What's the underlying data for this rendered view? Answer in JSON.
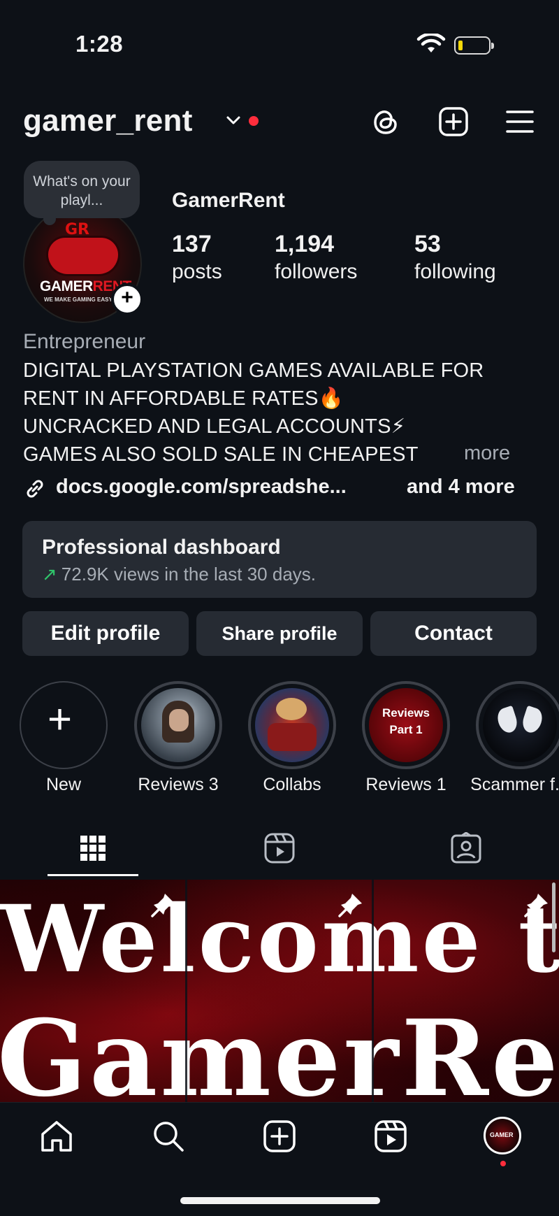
{
  "status_bar": {
    "time": "1:28"
  },
  "header": {
    "username": "gamer_rent"
  },
  "profile": {
    "note": "What's on your playl...",
    "avatar_brand_a": "GAMER",
    "avatar_brand_b": "RENT",
    "avatar_initials": "GR",
    "avatar_tagline": "WE MAKE GAMING EASY",
    "display_name": "GamerRent",
    "stats": [
      {
        "value": "137",
        "label": "posts"
      },
      {
        "value": "1,194",
        "label": "followers"
      },
      {
        "value": "53",
        "label": "following"
      }
    ],
    "category": "Entrepreneur",
    "bio_lines": [
      "DIGITAL PLAYSTATION GAMES AVAILABLE FOR",
      "RENT IN AFFORDABLE RATES🔥",
      "UNCRACKED AND LEGAL ACCOUNTS⚡",
      "GAMES ALSO SOLD SALE IN CHEAPEST"
    ],
    "bio_more": "more",
    "link_text": "docs.google.com/spreadshe...",
    "link_more": "and 4 more"
  },
  "dashboard": {
    "title": "Professional dashboard",
    "subtitle": "72.9K views in the last 30 days."
  },
  "buttons": {
    "edit": "Edit profile",
    "share": "Share profile",
    "contact": "Contact"
  },
  "highlights": [
    {
      "label": "New"
    },
    {
      "label": "Reviews 3"
    },
    {
      "label": "Collabs"
    },
    {
      "label": "Reviews 1",
      "cover_text_1": "Reviews",
      "cover_text_2": "Part 1"
    },
    {
      "label": "Scammer f..."
    }
  ],
  "grid": {
    "line1": "Welcome to",
    "line2": "GamerRent!"
  },
  "colors": {
    "background": "#0d1117",
    "card": "#262b33",
    "accent_red": "#ff2d3c",
    "trend_green": "#2fc46a"
  },
  "icons": {
    "header": [
      "threads-icon",
      "create-icon",
      "menu-icon"
    ],
    "tabs": [
      "grid-icon",
      "reels-icon",
      "tagged-icon"
    ],
    "bottom_nav": [
      "home-icon",
      "search-icon",
      "create-icon",
      "reels-icon",
      "profile-avatar"
    ]
  }
}
